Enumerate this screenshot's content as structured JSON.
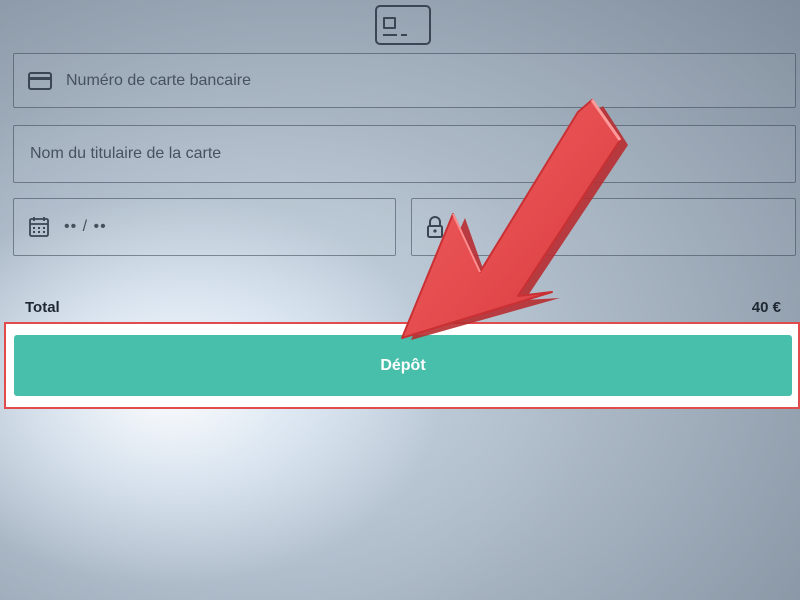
{
  "form": {
    "card_number_placeholder": "Numéro de carte bancaire",
    "cardholder_placeholder": "Nom du titulaire de la carte",
    "expiry_placeholder": "•• / ••"
  },
  "summary": {
    "total_label": "Total",
    "total_value": "40 €"
  },
  "actions": {
    "deposit_label": "Dépôt"
  },
  "icons": {
    "header": "credit-card-icon",
    "card_field": "credit-card-icon",
    "expiry_field": "calendar-icon",
    "cvv_field": "lock-icon",
    "annotation": "arrow-pointer-icon"
  },
  "colors": {
    "button": "#48bfaa",
    "highlight": "#e24b4b",
    "arrow": "#e5484a"
  }
}
